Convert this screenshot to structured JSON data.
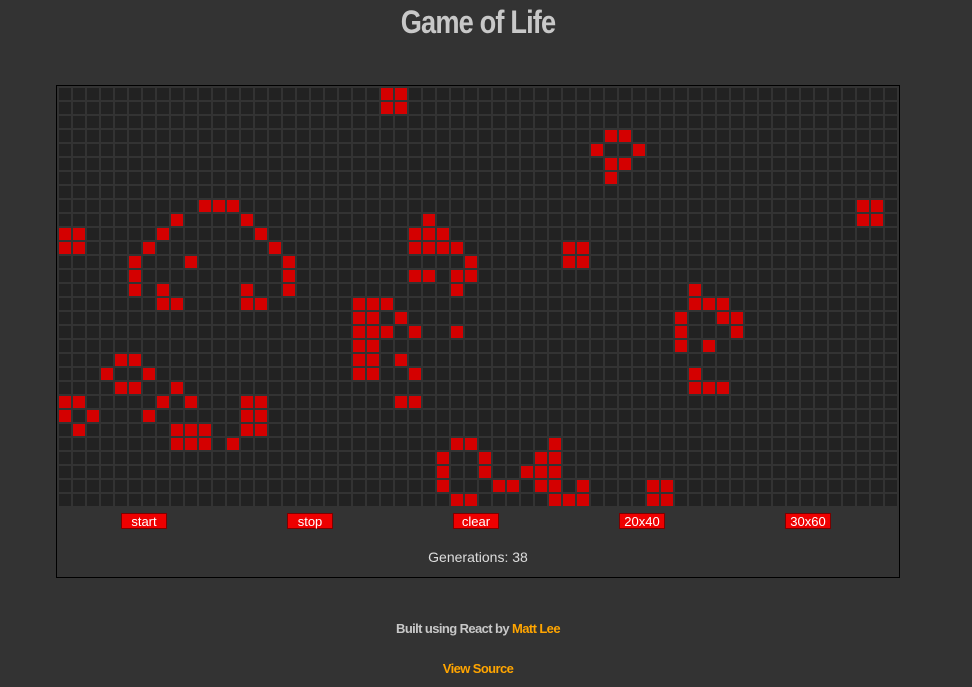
{
  "app": {
    "title": "Game of Life"
  },
  "board": {
    "rows": 30,
    "cols": 60,
    "live_cells": [
      [
        0,
        23
      ],
      [
        0,
        24
      ],
      [
        1,
        23
      ],
      [
        1,
        24
      ],
      [
        3,
        39
      ],
      [
        3,
        40
      ],
      [
        4,
        38
      ],
      [
        4,
        41
      ],
      [
        5,
        39
      ],
      [
        5,
        40
      ],
      [
        6,
        39
      ],
      [
        8,
        10
      ],
      [
        8,
        11
      ],
      [
        8,
        12
      ],
      [
        8,
        57
      ],
      [
        8,
        58
      ],
      [
        9,
        8
      ],
      [
        9,
        13
      ],
      [
        9,
        26
      ],
      [
        9,
        57
      ],
      [
        9,
        58
      ],
      [
        10,
        0
      ],
      [
        10,
        1
      ],
      [
        10,
        7
      ],
      [
        10,
        14
      ],
      [
        10,
        25
      ],
      [
        10,
        26
      ],
      [
        10,
        27
      ],
      [
        11,
        0
      ],
      [
        11,
        1
      ],
      [
        11,
        6
      ],
      [
        11,
        15
      ],
      [
        11,
        25
      ],
      [
        11,
        26
      ],
      [
        11,
        27
      ],
      [
        11,
        28
      ],
      [
        11,
        36
      ],
      [
        11,
        37
      ],
      [
        12,
        5
      ],
      [
        12,
        9
      ],
      [
        12,
        16
      ],
      [
        12,
        29
      ],
      [
        12,
        36
      ],
      [
        12,
        37
      ],
      [
        13,
        5
      ],
      [
        13,
        16
      ],
      [
        13,
        25
      ],
      [
        13,
        26
      ],
      [
        13,
        28
      ],
      [
        13,
        29
      ],
      [
        14,
        5
      ],
      [
        14,
        7
      ],
      [
        14,
        13
      ],
      [
        14,
        16
      ],
      [
        14,
        28
      ],
      [
        14,
        45
      ],
      [
        15,
        7
      ],
      [
        15,
        8
      ],
      [
        15,
        13
      ],
      [
        15,
        14
      ],
      [
        15,
        21
      ],
      [
        15,
        22
      ],
      [
        15,
        23
      ],
      [
        15,
        45
      ],
      [
        15,
        46
      ],
      [
        15,
        47
      ],
      [
        16,
        21
      ],
      [
        16,
        22
      ],
      [
        16,
        24
      ],
      [
        16,
        44
      ],
      [
        16,
        47
      ],
      [
        16,
        48
      ],
      [
        17,
        21
      ],
      [
        17,
        22
      ],
      [
        17,
        23
      ],
      [
        17,
        25
      ],
      [
        17,
        28
      ],
      [
        17,
        44
      ],
      [
        17,
        48
      ],
      [
        18,
        21
      ],
      [
        18,
        22
      ],
      [
        18,
        44
      ],
      [
        18,
        46
      ],
      [
        19,
        4
      ],
      [
        19,
        5
      ],
      [
        19,
        21
      ],
      [
        19,
        22
      ],
      [
        19,
        24
      ],
      [
        20,
        3
      ],
      [
        20,
        6
      ],
      [
        20,
        21
      ],
      [
        20,
        22
      ],
      [
        20,
        25
      ],
      [
        20,
        45
      ],
      [
        21,
        4
      ],
      [
        21,
        5
      ],
      [
        21,
        8
      ],
      [
        21,
        45
      ],
      [
        21,
        46
      ],
      [
        21,
        47
      ],
      [
        22,
        0
      ],
      [
        22,
        1
      ],
      [
        22,
        7
      ],
      [
        22,
        9
      ],
      [
        22,
        13
      ],
      [
        22,
        14
      ],
      [
        22,
        24
      ],
      [
        22,
        25
      ],
      [
        23,
        0
      ],
      [
        23,
        2
      ],
      [
        23,
        6
      ],
      [
        23,
        13
      ],
      [
        23,
        14
      ],
      [
        24,
        1
      ],
      [
        24,
        8
      ],
      [
        24,
        9
      ],
      [
        24,
        10
      ],
      [
        24,
        13
      ],
      [
        24,
        14
      ],
      [
        25,
        8
      ],
      [
        25,
        9
      ],
      [
        25,
        10
      ],
      [
        25,
        12
      ],
      [
        25,
        28
      ],
      [
        25,
        29
      ],
      [
        25,
        35
      ],
      [
        26,
        27
      ],
      [
        26,
        30
      ],
      [
        26,
        34
      ],
      [
        26,
        35
      ],
      [
        27,
        27
      ],
      [
        27,
        30
      ],
      [
        27,
        33
      ],
      [
        27,
        34
      ],
      [
        27,
        35
      ],
      [
        28,
        27
      ],
      [
        28,
        31
      ],
      [
        28,
        32
      ],
      [
        28,
        34
      ],
      [
        28,
        35
      ],
      [
        28,
        37
      ],
      [
        28,
        42
      ],
      [
        28,
        43
      ],
      [
        29,
        28
      ],
      [
        29,
        29
      ],
      [
        29,
        35
      ],
      [
        29,
        36
      ],
      [
        29,
        37
      ],
      [
        29,
        42
      ],
      [
        29,
        43
      ]
    ]
  },
  "controls": {
    "start": "start",
    "stop": "stop",
    "clear": "clear",
    "size_small": "20x40",
    "size_large": "30x60"
  },
  "status": {
    "generations_label": "Generations:",
    "generations_count": "38"
  },
  "footer": {
    "credit_prefix": "Built using React by",
    "author": "Matt Lee",
    "source_link": "View Source"
  },
  "colors": {
    "background": "#333333",
    "dead_cell": "#222222",
    "live_cell": "#d40000",
    "button": "#ee0000",
    "link": "#ffa500"
  }
}
